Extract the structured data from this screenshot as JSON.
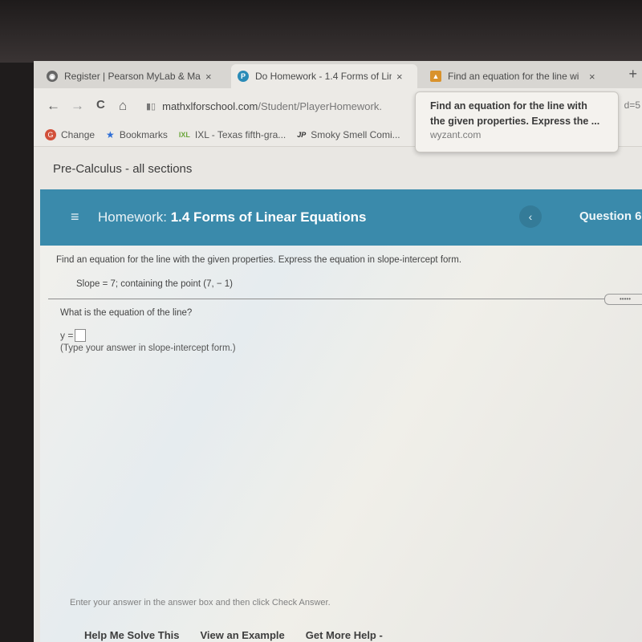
{
  "browser": {
    "tabs": [
      {
        "title": "Register | Pearson MyLab & Mas",
        "icon": "globe-icon",
        "active": false
      },
      {
        "title": "Do Homework - 1.4 Forms of Lin",
        "icon": "pearson-icon",
        "active": true
      },
      {
        "title": "Find an equation for the line wi",
        "icon": "wyzant-icon",
        "active": false
      }
    ],
    "close_glyph": "×",
    "new_tab_glyph": "+",
    "nav": {
      "back": "←",
      "forward": "→",
      "reload": "C",
      "home": "⌂"
    },
    "url_domain": "mathxlforschool.com",
    "url_path": "/Student/PlayerHomework.",
    "url_overflow": "d=5",
    "bookmarks": [
      {
        "label": "Change",
        "icon": "google-icon"
      },
      {
        "label": "Bookmarks",
        "icon": "star-icon"
      },
      {
        "label": "IXL - Texas fifth-gra...",
        "icon": "ixl-icon"
      },
      {
        "label": "Smoky Smell Comi...",
        "icon": "jp-icon"
      }
    ],
    "tooltip": {
      "title": "Find an equation for the line with the given properties. Express the ...",
      "domain": "wyzant.com"
    }
  },
  "page": {
    "course": "Pre-Calculus - all sections",
    "homework_prefix": "Homework:",
    "homework_title": "1.4 Forms of Linear Equations",
    "prev_glyph": "‹",
    "question_label": "Question 6",
    "prompt": "Find an equation for the line with the given properties. Express the equation in slope-intercept form.",
    "given": "Slope = 7; containing the point (7, − 1)",
    "more_glyph": "•••••",
    "question": "What is the equation of the line?",
    "answer_prefix": "y =",
    "answer_value": "",
    "hint": "(Type your answer in slope-intercept form.)",
    "footer_note": "Enter your answer in the answer box and then click Check Answer.",
    "help_buttons": [
      "Help Me Solve This",
      "View an Example",
      "Get More Help -"
    ]
  }
}
